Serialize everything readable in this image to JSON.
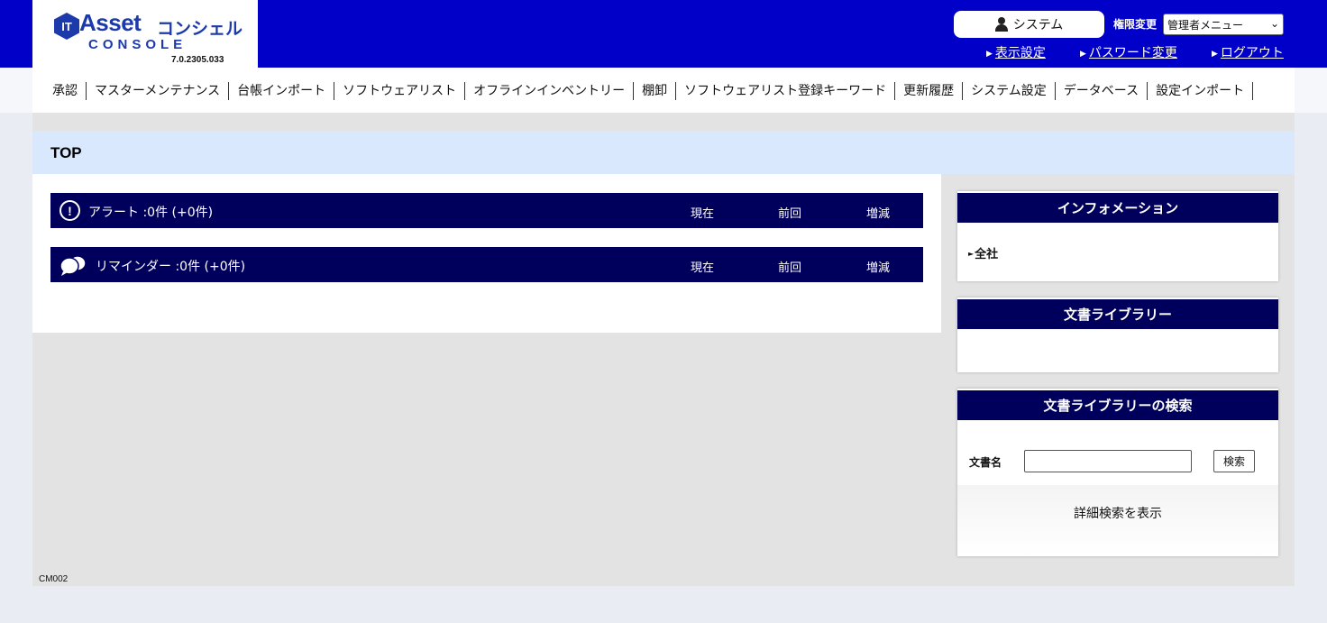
{
  "header": {
    "logo": {
      "it": "IT",
      "asset": "Asset",
      "concierge": "コンシェル",
      "console": "CONSOLE",
      "version": "7.0.2305.033"
    },
    "user_label": "システム",
    "role_label": "権限変更",
    "role_selected": "管理者メニュー",
    "links": {
      "display_settings": "表示設定",
      "password_change": "パスワード変更",
      "logout": "ログアウト"
    },
    "bg_color": "#0000c8"
  },
  "nav": {
    "items": [
      "承認",
      "マスターメンテナンス",
      "台帳インポート",
      "ソフトウェアリスト",
      "オフラインインベントリー",
      "棚卸",
      "ソフトウェアリスト登録キーワード",
      "更新履歴",
      "システム設定",
      "データベース",
      "設定インポート"
    ]
  },
  "page": {
    "title": "TOP",
    "screen_id": "CM002"
  },
  "status": {
    "alert": {
      "label": "アラート :0件 (+0件)",
      "icon": "exclamation-circle-icon"
    },
    "reminder": {
      "label": "リマインダー :0件 (+0件)",
      "icon": "speech-bubbles-icon"
    },
    "columns": {
      "now": "現在",
      "previous": "前回",
      "diff": "増減"
    },
    "bar_color": "#00005c"
  },
  "sidebar": {
    "information": {
      "title": "インフォメーション",
      "items": [
        "全社"
      ]
    },
    "library": {
      "title": "文書ライブラリー"
    },
    "library_search": {
      "title": "文書ライブラリーの検索",
      "field_label": "文書名",
      "field_value": "",
      "button_label": "検索",
      "detail_link": "詳細検索を表示"
    }
  }
}
